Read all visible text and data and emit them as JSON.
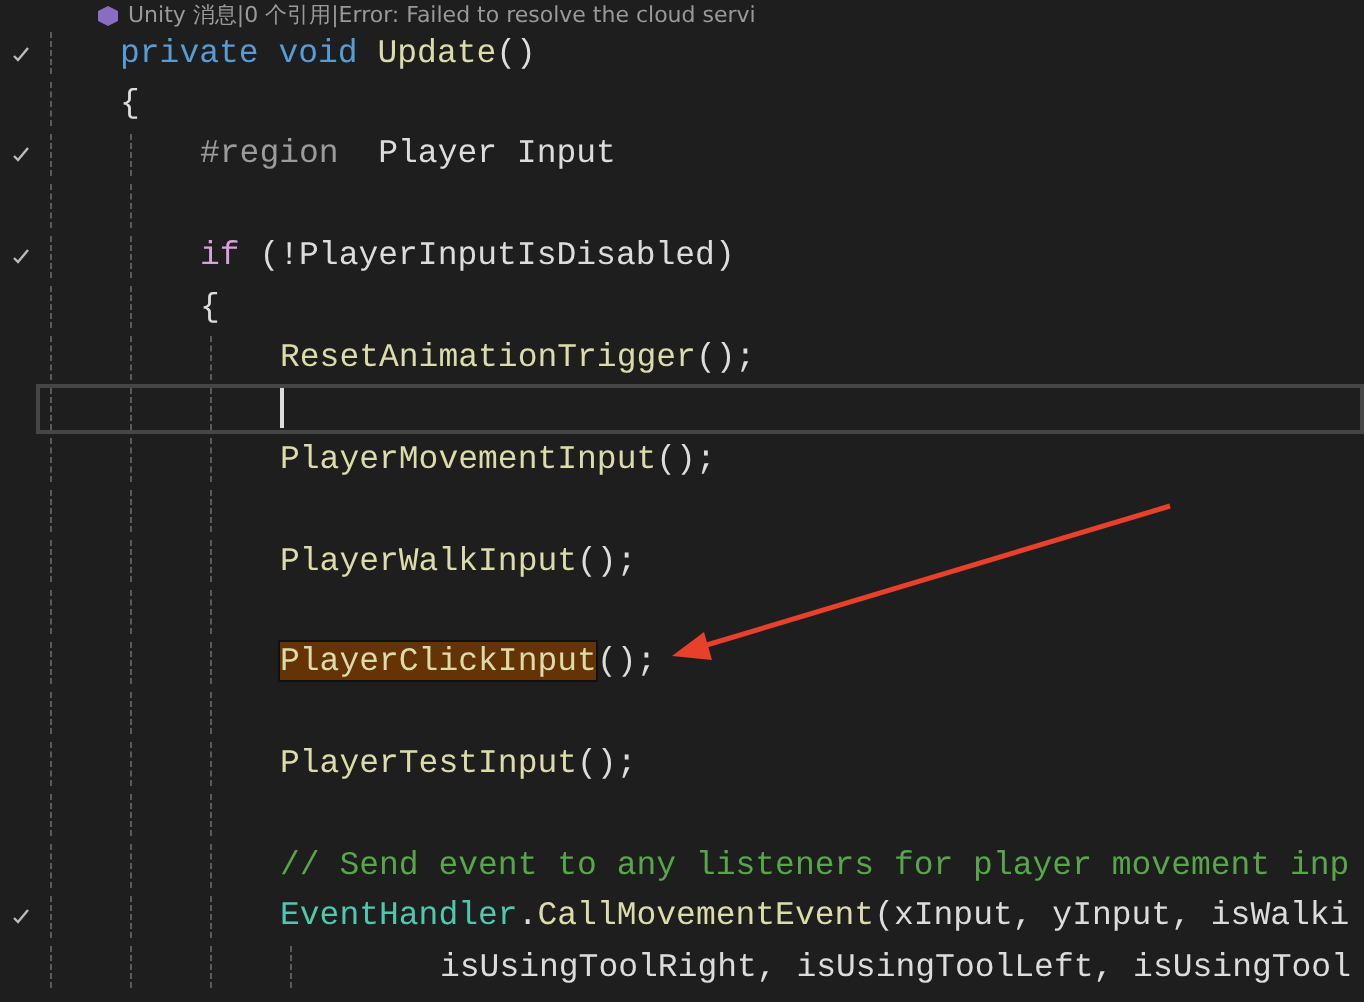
{
  "codelens": {
    "text": "Unity 消息|0 个引用|Error: Failed to resolve the cloud servi"
  },
  "lines": [
    {
      "marked": true,
      "current": false,
      "tokens": [
        {
          "kind": "keyword",
          "text": "private void "
        },
        {
          "kind": "method",
          "text": "Update"
        },
        {
          "kind": "plain",
          "text": "()"
        }
      ]
    },
    {
      "marked": false,
      "current": false,
      "tokens": [
        {
          "kind": "plain",
          "text": "{"
        }
      ],
      "children": [
        {
          "marked": true,
          "current": false,
          "tokens": [
            {
              "kind": "preproc",
              "text": "#region  "
            },
            {
              "kind": "plain",
              "text": "Player Input"
            }
          ]
        },
        {
          "marked": false,
          "current": false
        },
        {
          "marked": true,
          "current": false,
          "tokens": [
            {
              "kind": "control",
              "text": "if"
            },
            {
              "kind": "plain",
              "text": " (!PlayerInputIsDisabled)"
            }
          ]
        },
        {
          "marked": false,
          "current": false,
          "tokens": [
            {
              "kind": "plain",
              "text": "{"
            }
          ],
          "children": [
            {
              "marked": false,
              "current": false,
              "tokens": [
                {
                  "kind": "method",
                  "text": "ResetAnimationTrigger"
                },
                {
                  "kind": "plain",
                  "text": "();"
                }
              ]
            },
            {
              "marked": false,
              "current": true
            },
            {
              "marked": false,
              "current": false,
              "tokens": [
                {
                  "kind": "method",
                  "text": "PlayerMovementInput"
                },
                {
                  "kind": "plain",
                  "text": "();"
                }
              ]
            },
            {
              "marked": false,
              "current": false
            },
            {
              "marked": false,
              "current": false,
              "tokens": [
                {
                  "kind": "method",
                  "text": "PlayerWalkInput"
                },
                {
                  "kind": "plain",
                  "text": "();"
                }
              ]
            },
            {
              "marked": false,
              "current": false
            },
            {
              "marked": false,
              "current": false,
              "tokens": [
                {
                  "kind": "method",
                  "text": "PlayerClickInput",
                  "highlight": true
                },
                {
                  "kind": "plain",
                  "text": "();"
                }
              ]
            },
            {
              "marked": false,
              "current": false
            },
            {
              "marked": false,
              "current": false,
              "tokens": [
                {
                  "kind": "method",
                  "text": "PlayerTestInput"
                },
                {
                  "kind": "plain",
                  "text": "();"
                }
              ]
            },
            {
              "marked": false,
              "current": false
            },
            {
              "marked": false,
              "current": false,
              "tokens": [
                {
                  "kind": "comment",
                  "text": "// Send event to any listeners for player movement inp"
                }
              ]
            },
            {
              "marked": true,
              "current": false,
              "tokens": [
                {
                  "kind": "type",
                  "text": "EventHandler"
                },
                {
                  "kind": "plain",
                  "text": "."
                },
                {
                  "kind": "method",
                  "text": "CallMovementEvent"
                },
                {
                  "kind": "plain",
                  "text": "(xInput, yInput, isWalki"
                }
              ],
              "children": [
                {
                  "marked": false,
                  "current": false,
                  "continuation": true,
                  "tokens": [
                    {
                      "kind": "plain",
                      "text": "isUsingToolRight, isUsingToolLeft, isUsingTool"
                    }
                  ]
                }
              ]
            }
          ]
        }
      ]
    }
  ]
}
